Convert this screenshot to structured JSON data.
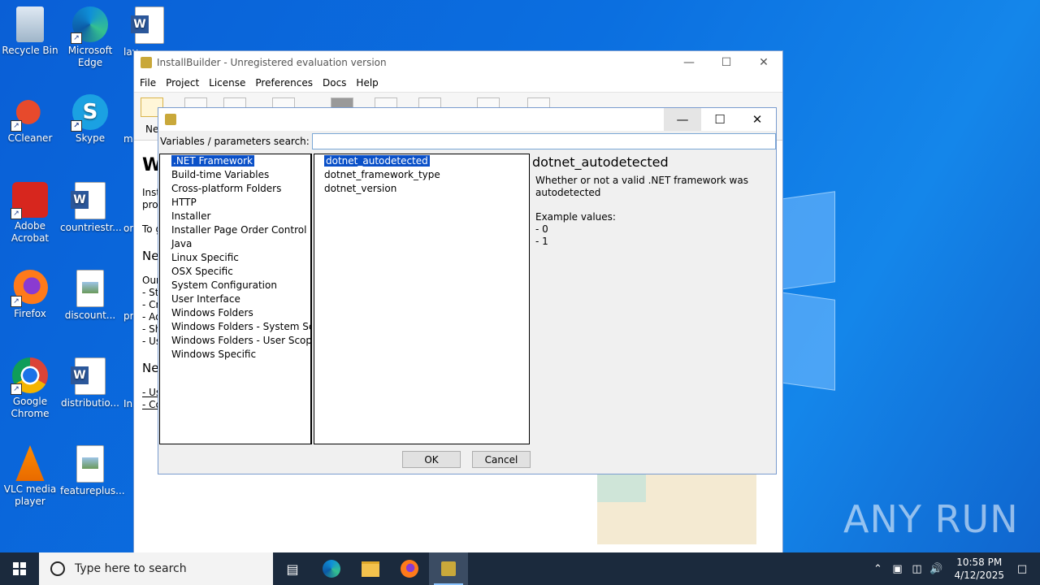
{
  "desktop": {
    "icons": [
      {
        "label": "Recycle Bin"
      },
      {
        "label": "Microsoft Edge"
      },
      {
        "label": "lav"
      },
      {
        "label": "CCleaner"
      },
      {
        "label": "Skype"
      },
      {
        "label": "m"
      },
      {
        "label": "Adobe Acrobat"
      },
      {
        "label": "countriestr..."
      },
      {
        "label": "or"
      },
      {
        "label": "Firefox"
      },
      {
        "label": "discount..."
      },
      {
        "label": "pr"
      },
      {
        "label": "Google Chrome"
      },
      {
        "label": "distributio..."
      },
      {
        "label": "In"
      },
      {
        "label": "VLC media player"
      },
      {
        "label": "featureplus..."
      }
    ],
    "watermark": "ANY RUN"
  },
  "main_window": {
    "title": "InstallBuilder - Unregistered evaluation version",
    "menu": [
      "File",
      "Project",
      "License",
      "Preferences",
      "Docs",
      "Help"
    ],
    "toolbar_new_label": "New",
    "bg_text": {
      "heading": "W",
      "line1": "Inst",
      "line2": "prov",
      "line3": "To g",
      "heading2": "Ne",
      "ours": "Our",
      "b1": "- St",
      "b2": "- Cr",
      "b3": "- Ad",
      "b4": "- Sh",
      "b5": "- Us",
      "heading3": "Ne",
      "l1": "- Us",
      "l2": "- Co"
    }
  },
  "dialog": {
    "search_label": "Variables / parameters search:",
    "search_value": "",
    "categories": [
      ".NET Framework",
      "Build-time Variables",
      "Cross-platform Folders",
      "HTTP",
      "Installer",
      "Installer Page Order Control",
      "Java",
      "Linux Specific",
      "OSX Specific",
      "System Configuration",
      "User Interface",
      "Windows Folders",
      "Windows Folders - System Scope",
      "Windows Folders - User Scope",
      "Windows Specific"
    ],
    "selected_category": ".NET Framework",
    "variables": [
      "dotnet_autodetected",
      "dotnet_framework_type",
      "dotnet_version"
    ],
    "selected_variable": "dotnet_autodetected",
    "detail_title": "dotnet_autodetected",
    "detail_text": "Whether or not a valid .NET framework was\nautodetected\n\nExample values:\n- 0\n- 1",
    "ok_label": "OK",
    "cancel_label": "Cancel"
  },
  "taskbar": {
    "search_placeholder": "Type here to search",
    "time": "10:58 PM",
    "date": "4/12/2025"
  }
}
